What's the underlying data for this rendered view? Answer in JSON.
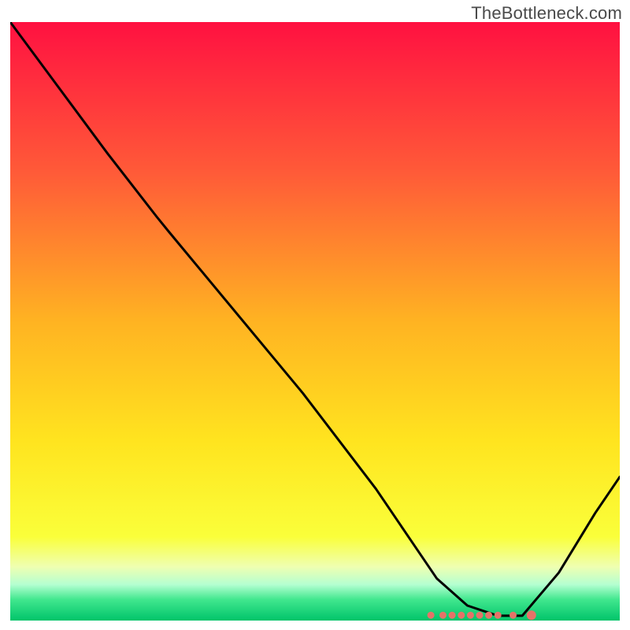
{
  "watermark": "TheBottleneck.com",
  "chart_data": {
    "type": "line",
    "title": "",
    "xlabel": "",
    "ylabel": "",
    "xlim": [
      0,
      100
    ],
    "ylim": [
      0,
      100
    ],
    "grid": false,
    "legend": false,
    "background": {
      "kind": "vertical-gradient",
      "stops": [
        {
          "pos": 0.0,
          "color": "#ff1141"
        },
        {
          "pos": 0.25,
          "color": "#ff5a38"
        },
        {
          "pos": 0.5,
          "color": "#ffb322"
        },
        {
          "pos": 0.7,
          "color": "#ffe41f"
        },
        {
          "pos": 0.86,
          "color": "#faff3a"
        },
        {
          "pos": 0.91,
          "color": "#efffb1"
        },
        {
          "pos": 0.94,
          "color": "#b4ffd1"
        },
        {
          "pos": 0.965,
          "color": "#41e78e"
        },
        {
          "pos": 1.0,
          "color": "#00c46a"
        }
      ]
    },
    "series": [
      {
        "name": "bottleneck-curve",
        "color": "#000000",
        "x": [
          0,
          8,
          16,
          24,
          26,
          48,
          60,
          66,
          70,
          75,
          80,
          84,
          90,
          96,
          100
        ],
        "y": [
          100,
          89,
          78,
          67.5,
          65,
          38,
          22,
          13,
          7,
          2.5,
          0.8,
          0.8,
          8,
          18,
          24
        ]
      }
    ],
    "markers": {
      "name": "optimal-range-dots",
      "color": "#e57368",
      "points": [
        {
          "x": 69,
          "y": 0.9
        },
        {
          "x": 71,
          "y": 0.9
        },
        {
          "x": 72.5,
          "y": 0.9
        },
        {
          "x": 74,
          "y": 0.9
        },
        {
          "x": 75.5,
          "y": 0.9
        },
        {
          "x": 77,
          "y": 0.9
        },
        {
          "x": 78.5,
          "y": 0.9
        },
        {
          "x": 80,
          "y": 0.9
        },
        {
          "x": 82.5,
          "y": 0.9
        },
        {
          "x": 85.5,
          "y": 0.9
        }
      ]
    }
  }
}
